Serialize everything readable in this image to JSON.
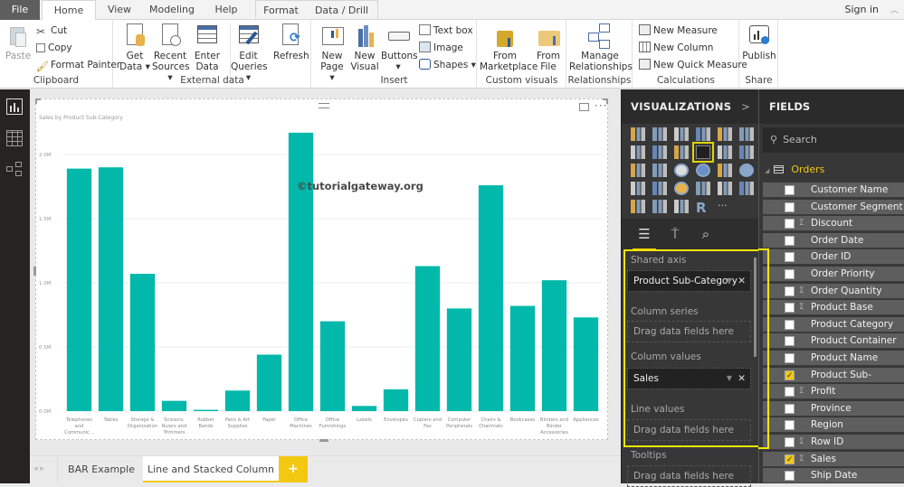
{
  "ribbon_tabs": [
    "File",
    "Home",
    "View",
    "Modeling",
    "Help",
    "Format",
    "Data / Drill"
  ],
  "sign_in": "Sign in",
  "ribbon": {
    "clipboard": {
      "label": "Clipboard",
      "paste": "Paste",
      "cut": "Cut",
      "copy": "Copy",
      "format_painter": "Format Painter"
    },
    "external_data": {
      "label": "External data",
      "get_data": [
        "Get",
        "Data ▾"
      ],
      "recent_sources": [
        "Recent",
        "Sources ▾"
      ],
      "enter_data": [
        "Enter",
        "Data"
      ],
      "edit_queries": [
        "Edit",
        "Queries ▾"
      ],
      "refresh": "Refresh"
    },
    "insert": {
      "label": "Insert",
      "new_page": [
        "New",
        "Page ▾"
      ],
      "new_visual": [
        "New",
        "Visual"
      ],
      "buttons": [
        "Buttons",
        "▾"
      ],
      "text_box": "Text box",
      "image": "Image",
      "shapes": "Shapes ▾"
    },
    "custom_visuals": {
      "label": "Custom visuals",
      "from_marketplace": [
        "From",
        "Marketplace"
      ],
      "from_file": [
        "From",
        "File"
      ]
    },
    "relationships": {
      "label": "Relationships",
      "manage": [
        "Manage",
        "Relationships"
      ]
    },
    "calculations": {
      "label": "Calculations",
      "new_measure": "New Measure",
      "new_column": "New Column",
      "new_quick_measure": "New Quick Measure"
    },
    "share": {
      "label": "Share",
      "publish": "Publish"
    }
  },
  "left_nav": [
    "report-view",
    "data-view",
    "relationships-view"
  ],
  "visual": {
    "more": "···",
    "watermark": "©tutorialgateway.org"
  },
  "chart_data": {
    "type": "bar",
    "title": "Sales by Product Sub-Category",
    "xlabel": "",
    "ylabel": "",
    "ylim": [
      0,
      2000000
    ],
    "yticks": [
      "0.0M",
      "0.5M",
      "1.0M",
      "1.5M",
      "2.0M"
    ],
    "ytick_values": [
      0,
      500000,
      1000000,
      1500000,
      2000000
    ],
    "grid": true,
    "color": "#01B8AA",
    "categories": [
      [
        "Telephones",
        "and",
        "Communic..."
      ],
      [
        "Tables"
      ],
      [
        "Storage &",
        "Organization"
      ],
      [
        "Scissors,",
        "Rulers and",
        "Trimmers"
      ],
      [
        "Rubber",
        "Bands"
      ],
      [
        "Pens & Art",
        "Supplies"
      ],
      [
        "Paper"
      ],
      [
        "Office",
        "Machines"
      ],
      [
        "Office",
        "Furnishings"
      ],
      [
        "Labels"
      ],
      [
        "Envelopes"
      ],
      [
        "Copiers and",
        "Fax"
      ],
      [
        "Computer",
        "Peripherals"
      ],
      [
        "Chairs &",
        "Chairmats"
      ],
      [
        "Bookcases"
      ],
      [
        "Binders and",
        "Binder",
        "Accessories"
      ],
      [
        "Appliances"
      ]
    ],
    "values": [
      1890000,
      1900000,
      1070000,
      80000,
      10000,
      160000,
      440000,
      2170000,
      700000,
      40000,
      170000,
      1130000,
      800000,
      1760000,
      820000,
      1020000,
      730000
    ]
  },
  "page_tabs": {
    "tabs": [
      "BAR Example",
      "Line and Stacked Column"
    ],
    "active": 1,
    "add": "+"
  },
  "visualizations": {
    "title": "VISUALIZATIONS",
    "expand": ">",
    "more": "···",
    "selected_index": 9,
    "wells": {
      "shared_axis": {
        "label": "Shared axis",
        "value": "Product Sub-Category"
      },
      "column_series": {
        "label": "Column series",
        "placeholder": "Drag data fields here"
      },
      "column_values": {
        "label": "Column values",
        "value": "Sales"
      },
      "line_values": {
        "label": "Line values",
        "placeholder": "Drag data fields here"
      },
      "tooltips": {
        "label": "Tooltips",
        "placeholder": "Drag data fields here"
      }
    }
  },
  "fields": {
    "title": "FIELDS",
    "search_placeholder": "Search",
    "table": "Orders",
    "items": [
      {
        "name": "Customer Name",
        "sigma": false,
        "checked": false
      },
      {
        "name": "Customer Segment",
        "sigma": false,
        "checked": false
      },
      {
        "name": "Discount",
        "sigma": true,
        "checked": false
      },
      {
        "name": "Order Date",
        "sigma": false,
        "checked": false
      },
      {
        "name": "Order ID",
        "sigma": false,
        "checked": false
      },
      {
        "name": "Order Priority",
        "sigma": false,
        "checked": false
      },
      {
        "name": "Order Quantity",
        "sigma": true,
        "checked": false
      },
      {
        "name": "Product Base Margin",
        "sigma": true,
        "checked": false
      },
      {
        "name": "Product Category",
        "sigma": false,
        "checked": false
      },
      {
        "name": "Product Container",
        "sigma": false,
        "checked": false
      },
      {
        "name": "Product Name",
        "sigma": false,
        "checked": false
      },
      {
        "name": "Product Sub-Category",
        "sigma": false,
        "checked": true
      },
      {
        "name": "Profit",
        "sigma": true,
        "checked": false
      },
      {
        "name": "Province",
        "sigma": false,
        "checked": false
      },
      {
        "name": "Region",
        "sigma": false,
        "checked": false
      },
      {
        "name": "Row ID",
        "sigma": true,
        "checked": false
      },
      {
        "name": "Sales",
        "sigma": true,
        "checked": true
      },
      {
        "name": "Ship Date",
        "sigma": false,
        "checked": false
      }
    ]
  }
}
